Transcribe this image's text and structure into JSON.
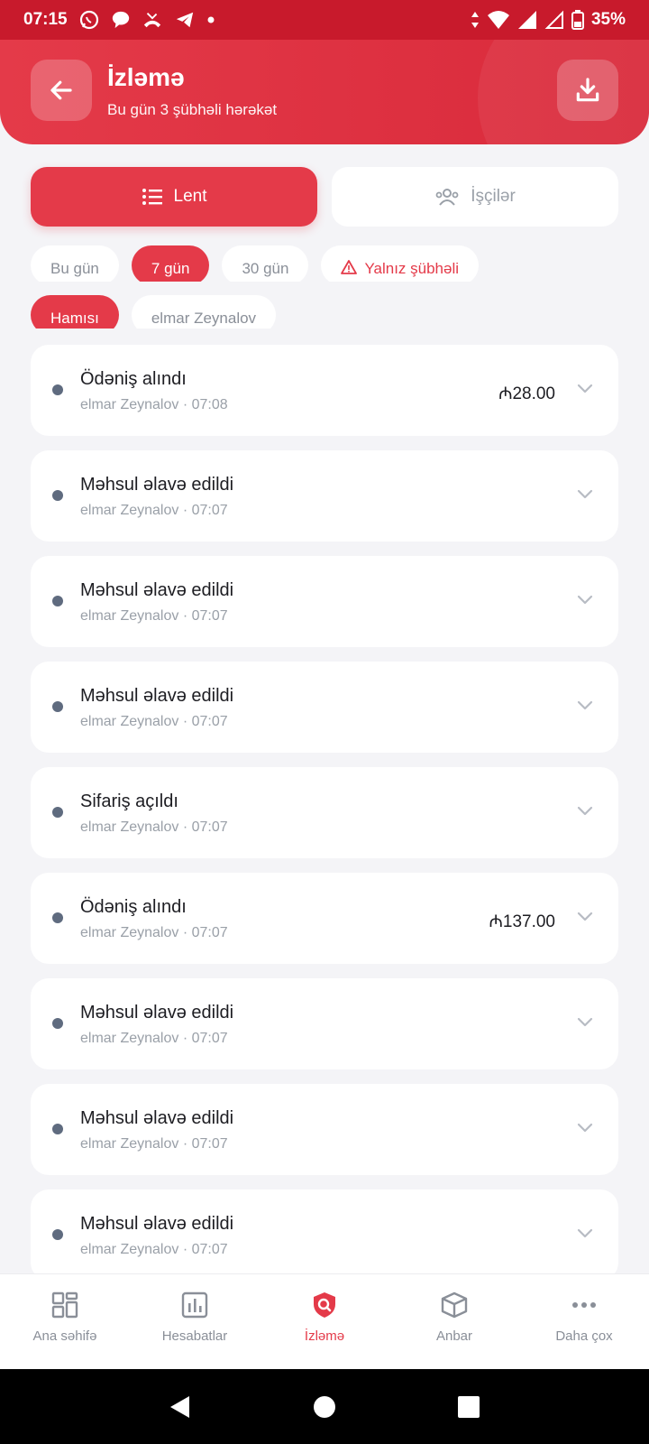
{
  "status_bar": {
    "time": "07:15",
    "battery": "35%"
  },
  "header": {
    "title": "İzləmə",
    "subtitle": "Bu gün 3 şübhəli hərəkət"
  },
  "tabs": [
    {
      "label": "Lent"
    },
    {
      "label": "İşçilər"
    }
  ],
  "period_filters": [
    "Bu gün",
    "7 gün",
    "30 gün",
    "Yalnız şübhəli"
  ],
  "user_filters": [
    "Hamısı",
    "elmar Zeynalov"
  ],
  "events": [
    {
      "title": "Ödəniş alındı",
      "meta": "elmar Zeynalov · 07:08",
      "amount": "₼28.00"
    },
    {
      "title": "Məhsul əlavə edildi",
      "meta": "elmar Zeynalov · 07:07",
      "amount": ""
    },
    {
      "title": "Məhsul əlavə edildi",
      "meta": "elmar Zeynalov · 07:07",
      "amount": ""
    },
    {
      "title": "Məhsul əlavə edildi",
      "meta": "elmar Zeynalov · 07:07",
      "amount": ""
    },
    {
      "title": "Sifariş açıldı",
      "meta": "elmar Zeynalov · 07:07",
      "amount": ""
    },
    {
      "title": "Ödəniş alındı",
      "meta": "elmar Zeynalov · 07:07",
      "amount": "₼137.00"
    },
    {
      "title": "Məhsul əlavə edildi",
      "meta": "elmar Zeynalov · 07:07",
      "amount": ""
    },
    {
      "title": "Məhsul əlavə edildi",
      "meta": "elmar Zeynalov · 07:07",
      "amount": ""
    },
    {
      "title": "Məhsul əlavə edildi",
      "meta": "elmar Zeynalov · 07:07",
      "amount": ""
    }
  ],
  "bottom_nav": [
    {
      "label": "Ana səhifə",
      "icon": "grid-icon"
    },
    {
      "label": "Hesabatlar",
      "icon": "chart-icon"
    },
    {
      "label": "İzləmə",
      "icon": "shield-search-icon"
    },
    {
      "label": "Anbar",
      "icon": "box-icon"
    },
    {
      "label": "Daha çox",
      "icon": "more-icon"
    }
  ],
  "colors": {
    "primary": "#e43a49",
    "status_bar": "#c81a2c",
    "background": "#f4f4f7"
  }
}
